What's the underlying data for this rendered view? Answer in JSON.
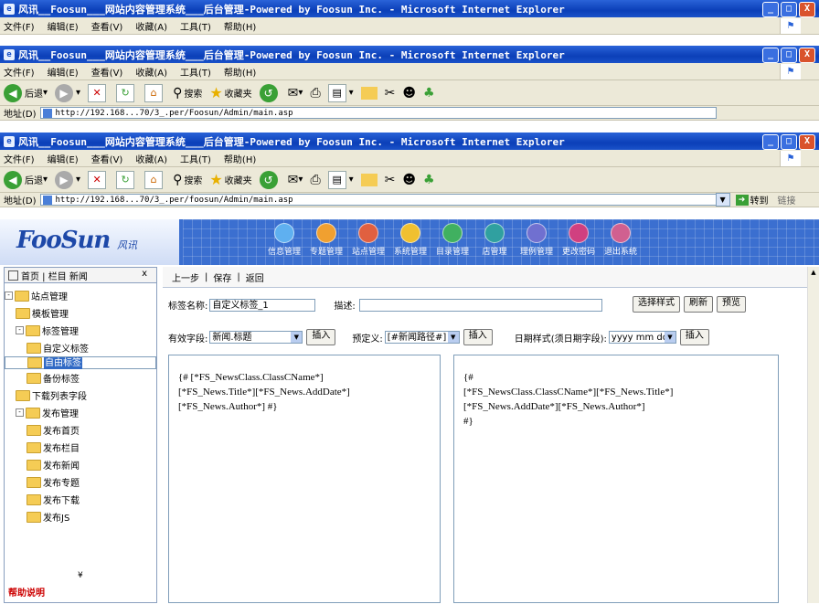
{
  "window": {
    "title": "风讯__Foosun___网站内容管理系统___后台管理-Powered by Foosun Inc. - Microsoft Internet Explorer",
    "min": "_",
    "max": "□",
    "close": "X"
  },
  "menu": [
    "文件(F)",
    "编辑(E)",
    "查看(V)",
    "收藏(A)",
    "工具(T)",
    "帮助(H)"
  ],
  "toolbar": {
    "back": "后退",
    "search": "搜索",
    "favorites": "收藏夹"
  },
  "address": {
    "label": "地址(D)",
    "url_top": "http://192.168...70/3_.per/Foosun/Admin/main.asp",
    "url": "http://192.168...70/3_.per/foosun/Admin/main.asp",
    "go": "转到",
    "links": "链接"
  },
  "app": {
    "logo": "FooSun",
    "logo_sub": "风讯",
    "nav": [
      "信息管理",
      "专题管理",
      "站点管理",
      "系统管理",
      "目录管理",
      "店管理",
      "理例管理",
      "更改密码",
      "退出系统"
    ]
  },
  "left": {
    "tabs": "首页 | 栏目 新闻",
    "close": "x",
    "tree": [
      {
        "label": "站点管理",
        "level": 0,
        "toggle": "-"
      },
      {
        "label": "模板管理",
        "level": 1
      },
      {
        "label": "标签管理",
        "level": 1,
        "toggle": "-"
      },
      {
        "label": "自定义标签",
        "level": 2
      },
      {
        "label": "自由标签",
        "level": 2,
        "selected": true
      },
      {
        "label": "备份标签",
        "level": 2
      },
      {
        "label": "下载列表字段",
        "level": 1
      },
      {
        "label": "发布管理",
        "level": 1,
        "toggle": "-"
      },
      {
        "label": "发布首页",
        "level": 2
      },
      {
        "label": "发布栏目",
        "level": 2
      },
      {
        "label": "发布新闻",
        "level": 2
      },
      {
        "label": "发布专题",
        "level": 2
      },
      {
        "label": "发布下载",
        "level": 2
      },
      {
        "label": "发布JS",
        "level": 2
      }
    ],
    "splitter": "¥",
    "help": "帮助说明"
  },
  "right": {
    "toolbar": {
      "back": "上一步",
      "save": "保存",
      "return": "返回"
    },
    "label_name": "标签名称:",
    "label_value": "自定义标签_1",
    "desc": "描述:",
    "btn_style": "选择样式",
    "btn_refresh": "刷新",
    "btn_preview": "预览",
    "field_label": "有效字段:",
    "field_value": "新闻.标题",
    "insert1": "插入",
    "preset_label": "预定义:",
    "preset_value": "[#新闻路径#]",
    "insert2": "插入",
    "date_label": "日期样式(须日期字段):",
    "date_value": "yyyy mm dd",
    "insert3": "插入",
    "editor_left": [
      "{# [*FS_NewsClass.ClassCName*]",
      "[*FS_News.Title*][*FS_News.AddDate*]",
      "[*FS_News.Author*] #}"
    ],
    "editor_right": [
      "{#",
      "[*FS_NewsClass.ClassCName*][*FS_News.Title*]",
      "[*FS_News.AddDate*][*FS_News.Author*]",
      "#}"
    ]
  }
}
